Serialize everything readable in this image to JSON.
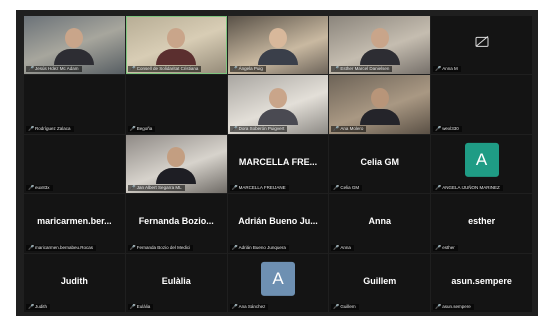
{
  "tiles": [
    {
      "type": "video",
      "label": "Jesús Hdez Mc Adam",
      "center": ""
    },
    {
      "type": "video",
      "label": "Consell de Solidaritat Cristiana",
      "center": ""
    },
    {
      "type": "video",
      "label": "Ángela Puig",
      "center": ""
    },
    {
      "type": "video",
      "label": "Esther Marcel Danielsen",
      "center": ""
    },
    {
      "type": "camoff",
      "label": "Anna M",
      "center": ""
    },
    {
      "type": "blank",
      "label": "Rodríguez Zalaca",
      "center": ""
    },
    {
      "type": "blank",
      "label": "Begoña",
      "center": ""
    },
    {
      "type": "video",
      "label": "Dora Soberón Puigvert",
      "center": ""
    },
    {
      "type": "video",
      "label": "Ana Molero",
      "center": ""
    },
    {
      "type": "blank",
      "label": "wexl330",
      "center": ""
    },
    {
      "type": "blank",
      "label": "eux83x",
      "center": ""
    },
    {
      "type": "video",
      "label": "Jan Albert Segarra ML",
      "center": ""
    },
    {
      "type": "name",
      "label": "MARCELLA FREIJANE",
      "center": "MARCELLA  FRE..."
    },
    {
      "type": "name",
      "label": "Celia GM",
      "center": "Celia GM"
    },
    {
      "type": "avatar",
      "label": "ANGELA IJUÑON MARINEZ",
      "center": "",
      "avatar": "A",
      "avatar_color": "#1f9c85"
    },
    {
      "type": "name",
      "label": "maricarmen.bernabeu.Rocas",
      "center": "maricarmen.ber..."
    },
    {
      "type": "name",
      "label": "Fernanda Bozio del Medici",
      "center": "Fernanda  Bozio..."
    },
    {
      "type": "name",
      "label": "Adrián Bueno Junquera",
      "center": "Adrián  Bueno  Ju..."
    },
    {
      "type": "name",
      "label": "Anna",
      "center": "Anna"
    },
    {
      "type": "name",
      "label": "esther",
      "center": "esther"
    },
    {
      "type": "name",
      "label": "Judith",
      "center": "Judith"
    },
    {
      "type": "name",
      "label": "Eulàlia",
      "center": "Eulàlia"
    },
    {
      "type": "avatar",
      "label": "Ana Sánchez",
      "center": "",
      "avatar": "A",
      "avatar_color": "#6e90b2"
    },
    {
      "type": "name",
      "label": "Guillem",
      "center": "Guillem"
    },
    {
      "type": "name",
      "label": "asun.sempere",
      "center": "asun.sempere"
    }
  ]
}
